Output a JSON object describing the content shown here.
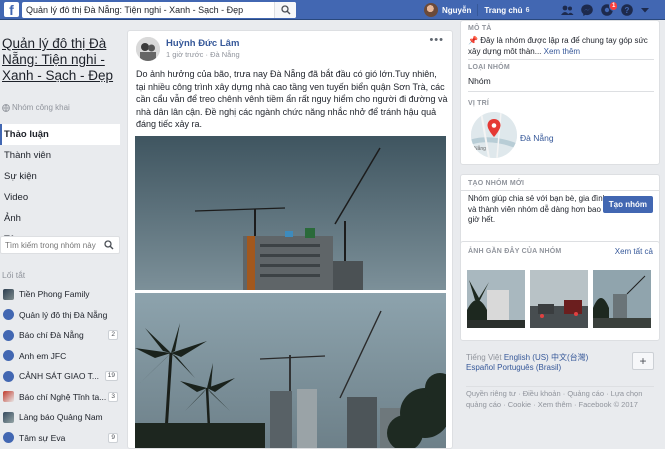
{
  "topbar": {
    "logo": "f",
    "search_value": "Quản lý đô thị Đà Nẵng: Tiện nghi - Xanh - Sạch - Đẹp",
    "user_name": "Nguyễn",
    "home_label": "Trang chủ",
    "home_count": "6",
    "notification_badge": "1"
  },
  "left": {
    "group_title": "Quản lý đô thị Đà Nẵng: Tiện nghi - Xanh - Sạch - Đẹp",
    "privacy": "Nhóm công khai",
    "nav": [
      "Thảo luận",
      "Thành viên",
      "Sự kiện",
      "Video",
      "Ảnh",
      "Tệp"
    ],
    "search_placeholder": "Tìm kiếm trong nhóm này",
    "shortcuts_label": "Lối tắt",
    "shortcuts": [
      {
        "label": "Tiền Phong Family",
        "count": "",
        "icon": "page-icon"
      },
      {
        "label": "Quản lý đô thị Đà Nẵng:...",
        "count": "",
        "icon": "group-icon"
      },
      {
        "label": "Báo chí Đà Nẵng",
        "count": "2",
        "icon": "group-icon"
      },
      {
        "label": "Anh em JFC",
        "count": "",
        "icon": "group-icon"
      },
      {
        "label": "CẢNH SÁT GIAO T...",
        "count": "19",
        "icon": "group-icon"
      },
      {
        "label": "Báo chí Nghệ Tĩnh ta...",
        "count": "3",
        "icon": "page-icon"
      },
      {
        "label": "Làng báo Quảng Nam",
        "count": "",
        "icon": "page-icon"
      },
      {
        "label": "Tâm sự Eva",
        "count": "9",
        "icon": "group-icon"
      }
    ]
  },
  "post": {
    "author": "Huỳnh Đức Lâm",
    "time": "1 giờ trước",
    "location": "Đà Nẵng",
    "more": "•••",
    "text": "Do ảnh hưởng của bão, trưa nay Đà Nẵng đã bắt đầu có gió lớn.Tuy nhiên, tại nhiều công trình xây dựng nhà cao tầng ven tuyến biển quận Sơn Trà, các cần cẩu vẫn để treo chênh vênh tiềm ẩn rất nguy hiểm cho người đi đường và nhà dân lân cận. Đề nghị các ngành chức năng nhắc nhở để tránh hậu quả đáng tiếc xảy ra."
  },
  "right": {
    "about_label": "MÔ TẢ",
    "about_text": "Đây là nhóm được lập ra để chung tay góp sức xây dựng môt thàn...",
    "about_more": "Xem thêm",
    "type_label": "LOẠI NHÓM",
    "type_value": "Nhóm",
    "location_label": "VỊ TRÍ",
    "location_value": "Đà Nẵng",
    "create_label": "TẠO NHÓM MỚI",
    "create_text": "Nhóm giúp chia sẻ với bạn bè, gia đình và thành viên nhóm dễ dàng hơn bao giờ hết.",
    "create_button": "Tạo nhóm",
    "photos_label": "ẢNH GẦN ĐÂY CỦA NHÓM",
    "photos_see_all": "Xem tất cả",
    "languages": [
      "Tiếng Việt",
      "English (US)",
      "中文(台灣)",
      "Español",
      "Português (Brasil)"
    ],
    "footer": "Quyền riêng tư · Điều khoản · Quảng cáo · Lựa chọn quảng cáo · Cookie · Xem thêm · Facebook © 2017"
  },
  "colors": {
    "brand": "#4267b2",
    "link": "#365899",
    "background": "#e9ebee"
  }
}
